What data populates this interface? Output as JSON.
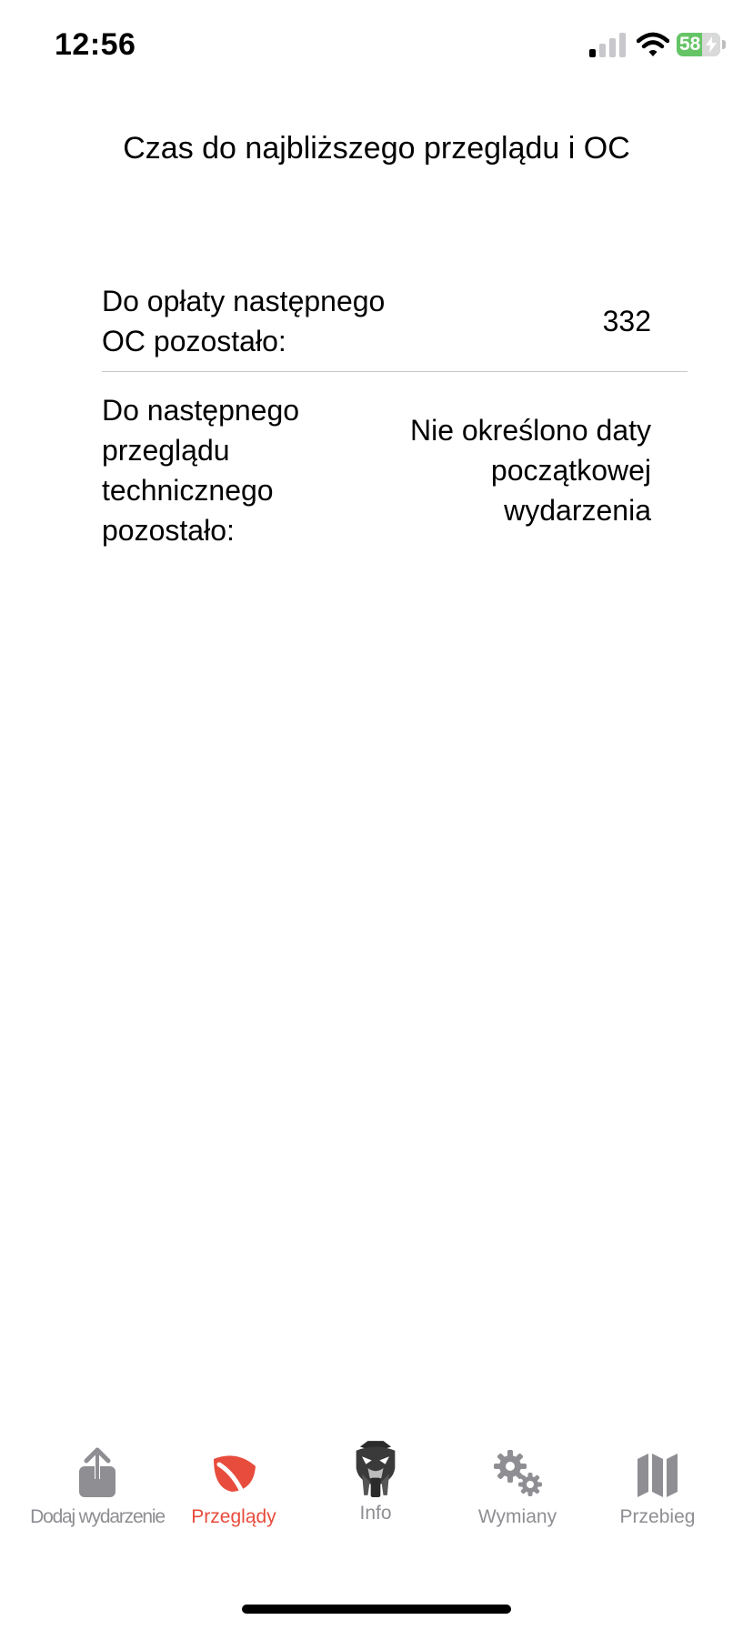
{
  "status_bar": {
    "time": "12:56",
    "battery_level": "58",
    "battery_fraction": 0.58
  },
  "page": {
    "title": "Czas do najbliższego przeglądu i OC"
  },
  "rows": [
    {
      "label": "Do opłaty następnego OC pozostało:",
      "value": "332"
    },
    {
      "label": "Do następnego przeglądu technicznego pozostało:",
      "value": "Nie określono daty początkowej wydarzenia"
    }
  ],
  "tab_bar": {
    "active_color": "#e74c3c",
    "inactive_color": "#8e8e93",
    "tabs": [
      {
        "label": "Dodaj wydarzenie",
        "icon": "share-icon"
      },
      {
        "label": "Przeglądy",
        "icon": "leaf-icon"
      },
      {
        "label": "Info",
        "icon": "cat-emblem-icon"
      },
      {
        "label": "Wymiany",
        "icon": "gears-icon"
      },
      {
        "label": "Przebieg",
        "icon": "map-icon"
      }
    ]
  }
}
